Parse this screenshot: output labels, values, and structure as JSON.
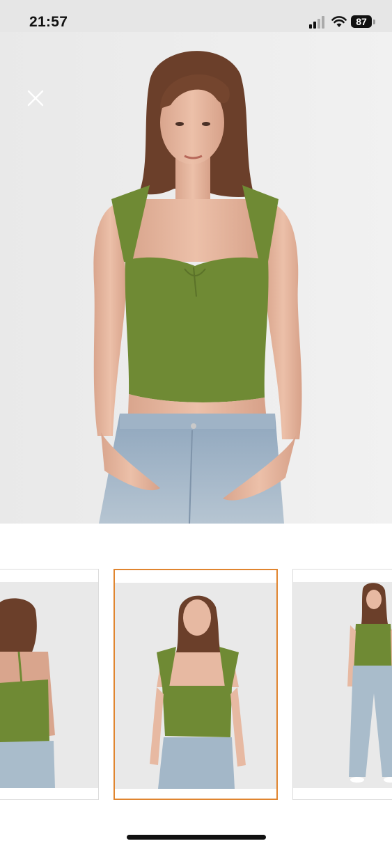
{
  "status_bar": {
    "time": "21:57",
    "battery": "87",
    "icons": [
      "signal-icon",
      "wifi-icon",
      "battery-icon"
    ]
  },
  "viewer": {
    "close_icon": "close-icon",
    "main_image": "model-front-view-olive-top",
    "thumbnails": [
      {
        "image": "model-back-view",
        "selected": false
      },
      {
        "image": "model-front-view",
        "selected": true
      },
      {
        "image": "model-full-length-view",
        "selected": false
      }
    ]
  },
  "colors": {
    "top_olive": "#6f8a34",
    "selected_border": "#e0852f",
    "background": "#ececec"
  }
}
